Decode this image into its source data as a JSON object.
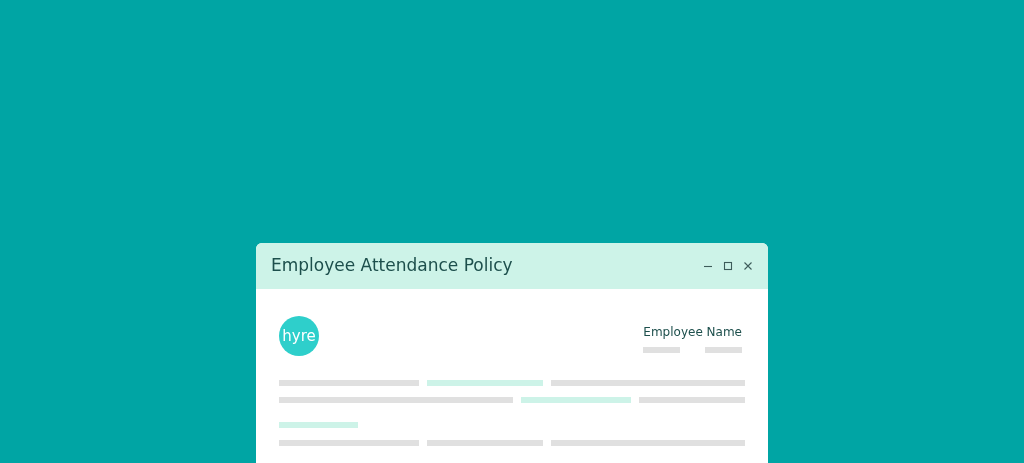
{
  "window": {
    "title": "Employee Attendance Policy"
  },
  "document": {
    "logo": "hyre",
    "field_label": "Employee Name",
    "text_rows": [
      {
        "segments": [
          {
            "kind": "plain"
          },
          {
            "kind": "highlight"
          },
          {
            "kind": "plain"
          }
        ]
      },
      {
        "segments": [
          {
            "kind": "plain"
          },
          {
            "kind": "highlight"
          },
          {
            "kind": "plain"
          }
        ]
      },
      {
        "segments": [
          {
            "kind": "highlight"
          }
        ]
      },
      {
        "segments": [
          {
            "kind": "plain"
          },
          {
            "kind": "plain"
          },
          {
            "kind": "plain"
          }
        ]
      }
    ]
  }
}
